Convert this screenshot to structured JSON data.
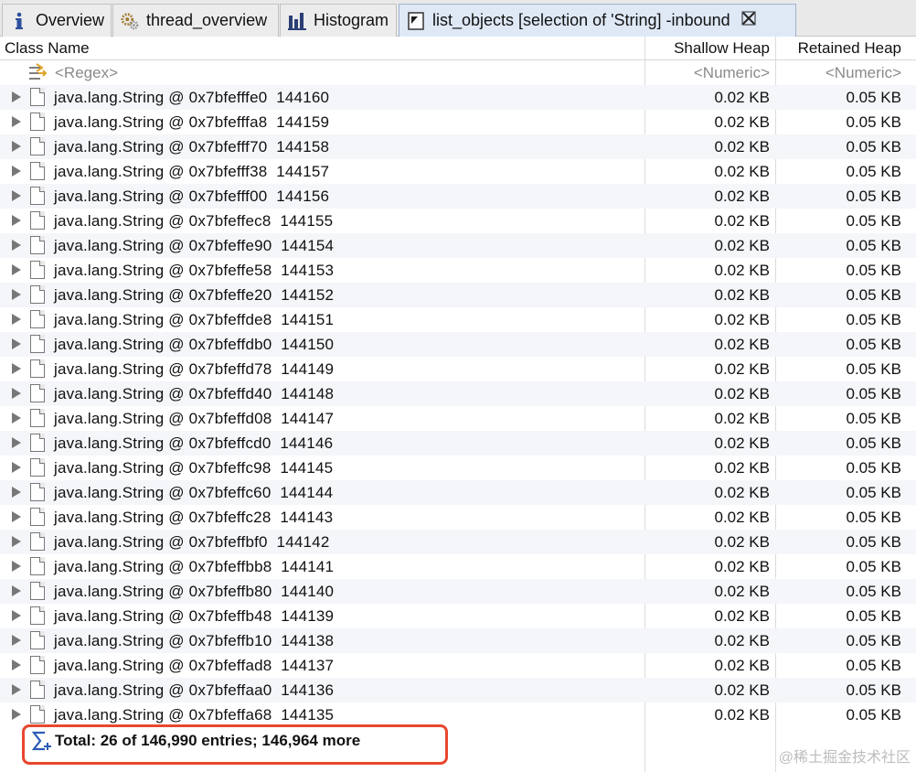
{
  "tabs": [
    {
      "label": "Overview",
      "icon": "info-icon"
    },
    {
      "label": "thread_overview",
      "icon": "gears-icon"
    },
    {
      "label": "Histogram",
      "icon": "bar-chart-icon"
    },
    {
      "label": "list_objects  [selection of 'String] -inbound",
      "icon": "list-objects-icon",
      "active": true,
      "close": "close-icon"
    }
  ],
  "columns": {
    "class_name": "Class Name",
    "shallow_heap": "Shallow Heap",
    "retained_heap": "Retained Heap"
  },
  "filter_row": {
    "regex": "<Regex>",
    "shallow": "<Numeric>",
    "retained": "<Numeric>"
  },
  "rows": [
    {
      "text": "java.lang.String @ 0x7bfefffe0  144160",
      "shallow": "0.02 KB",
      "retained": "0.05 KB"
    },
    {
      "text": "java.lang.String @ 0x7bfefffa8  144159",
      "shallow": "0.02 KB",
      "retained": "0.05 KB"
    },
    {
      "text": "java.lang.String @ 0x7bfefff70  144158",
      "shallow": "0.02 KB",
      "retained": "0.05 KB"
    },
    {
      "text": "java.lang.String @ 0x7bfefff38  144157",
      "shallow": "0.02 KB",
      "retained": "0.05 KB"
    },
    {
      "text": "java.lang.String @ 0x7bfefff00  144156",
      "shallow": "0.02 KB",
      "retained": "0.05 KB"
    },
    {
      "text": "java.lang.String @ 0x7bfeffec8  144155",
      "shallow": "0.02 KB",
      "retained": "0.05 KB"
    },
    {
      "text": "java.lang.String @ 0x7bfeffe90  144154",
      "shallow": "0.02 KB",
      "retained": "0.05 KB"
    },
    {
      "text": "java.lang.String @ 0x7bfeffe58  144153",
      "shallow": "0.02 KB",
      "retained": "0.05 KB"
    },
    {
      "text": "java.lang.String @ 0x7bfeffe20  144152",
      "shallow": "0.02 KB",
      "retained": "0.05 KB"
    },
    {
      "text": "java.lang.String @ 0x7bfeffde8  144151",
      "shallow": "0.02 KB",
      "retained": "0.05 KB"
    },
    {
      "text": "java.lang.String @ 0x7bfeffdb0  144150",
      "shallow": "0.02 KB",
      "retained": "0.05 KB"
    },
    {
      "text": "java.lang.String @ 0x7bfeffd78  144149",
      "shallow": "0.02 KB",
      "retained": "0.05 KB"
    },
    {
      "text": "java.lang.String @ 0x7bfeffd40  144148",
      "shallow": "0.02 KB",
      "retained": "0.05 KB"
    },
    {
      "text": "java.lang.String @ 0x7bfeffd08  144147",
      "shallow": "0.02 KB",
      "retained": "0.05 KB"
    },
    {
      "text": "java.lang.String @ 0x7bfeffcd0  144146",
      "shallow": "0.02 KB",
      "retained": "0.05 KB"
    },
    {
      "text": "java.lang.String @ 0x7bfeffc98  144145",
      "shallow": "0.02 KB",
      "retained": "0.05 KB"
    },
    {
      "text": "java.lang.String @ 0x7bfeffc60  144144",
      "shallow": "0.02 KB",
      "retained": "0.05 KB"
    },
    {
      "text": "java.lang.String @ 0x7bfeffc28  144143",
      "shallow": "0.02 KB",
      "retained": "0.05 KB"
    },
    {
      "text": "java.lang.String @ 0x7bfeffbf0  144142",
      "shallow": "0.02 KB",
      "retained": "0.05 KB"
    },
    {
      "text": "java.lang.String @ 0x7bfeffbb8  144141",
      "shallow": "0.02 KB",
      "retained": "0.05 KB"
    },
    {
      "text": "java.lang.String @ 0x7bfeffb80  144140",
      "shallow": "0.02 KB",
      "retained": "0.05 KB"
    },
    {
      "text": "java.lang.String @ 0x7bfeffb48  144139",
      "shallow": "0.02 KB",
      "retained": "0.05 KB"
    },
    {
      "text": "java.lang.String @ 0x7bfeffb10  144138",
      "shallow": "0.02 KB",
      "retained": "0.05 KB"
    },
    {
      "text": "java.lang.String @ 0x7bfeffad8  144137",
      "shallow": "0.02 KB",
      "retained": "0.05 KB"
    },
    {
      "text": "java.lang.String @ 0x7bfeffaa0  144136",
      "shallow": "0.02 KB",
      "retained": "0.05 KB"
    },
    {
      "text": "java.lang.String @ 0x7bfeffa68  144135",
      "shallow": "0.02 KB",
      "retained": "0.05 KB"
    }
  ],
  "total": {
    "text": "Total: 26 of 146,990 entries; 146,964 more",
    "icon": "sigma-icon"
  },
  "watermark": "@稀土掘金技术社区",
  "colors": {
    "highlight": "#e8472e",
    "active_tab": "#dfe9f6"
  }
}
